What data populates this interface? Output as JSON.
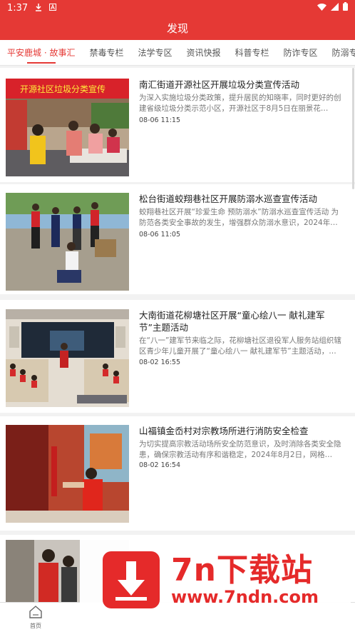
{
  "status_bar": {
    "time": "1:37",
    "icons": [
      "download-icon",
      "notification-a-icon",
      "wifi-icon",
      "signal-icon",
      "battery-icon"
    ]
  },
  "header": {
    "title": "发现"
  },
  "tabs": [
    {
      "label": "平安鹿城 · 故事汇",
      "active": true
    },
    {
      "label": "禁毒专栏",
      "active": false
    },
    {
      "label": "法学专区",
      "active": false
    },
    {
      "label": "资讯快报",
      "active": false
    },
    {
      "label": "科普专栏",
      "active": false
    },
    {
      "label": "防诈专区",
      "active": false
    },
    {
      "label": "防溺专",
      "active": false
    }
  ],
  "articles": [
    {
      "title": "南汇街道开源社区开展垃圾分类宣传活动",
      "desc": "为深入实施垃圾分类政策，提升居民的知晓率，同时更好的创建省级垃圾分类示范小区，开源社区于8月5日在丽景花…",
      "date": "08-06 11:15",
      "image_banner": "开源社区垃圾分类宣传"
    },
    {
      "title": "松台街道蛟翔巷社区开展防溺水巡查宣传活动",
      "desc": "蛟翔巷社区开展“珍爱生命 预防溺水”防溺水巡查宣传活动 为防范各类安全事故的发生，增强群众防溺水意识，2024年…",
      "date": "08-06 11:05"
    },
    {
      "title": "大南街道花柳塘社区开展“童心绘八一 献礼建军节”主题活动",
      "desc": "在“八一”建军节来临之际，花柳塘社区退役军人服务站组织辖区青少年儿童开展了“童心绘八一 献礼建军节”主题活动，…",
      "date": "08-02 16:55"
    },
    {
      "title": "山福镇金岙村对宗教场所进行消防安全检查",
      "desc": "为切实提高宗教活动场所安全防范意识，及时消除各类安全隐患，确保宗教活动有序和谐稳定，2024年8月2日，网格…",
      "date": "08-02 16:54"
    }
  ],
  "bottom_nav": {
    "home_label": "首页"
  },
  "watermark": {
    "title": "7n下载站",
    "url": "www.7ndn.com"
  }
}
